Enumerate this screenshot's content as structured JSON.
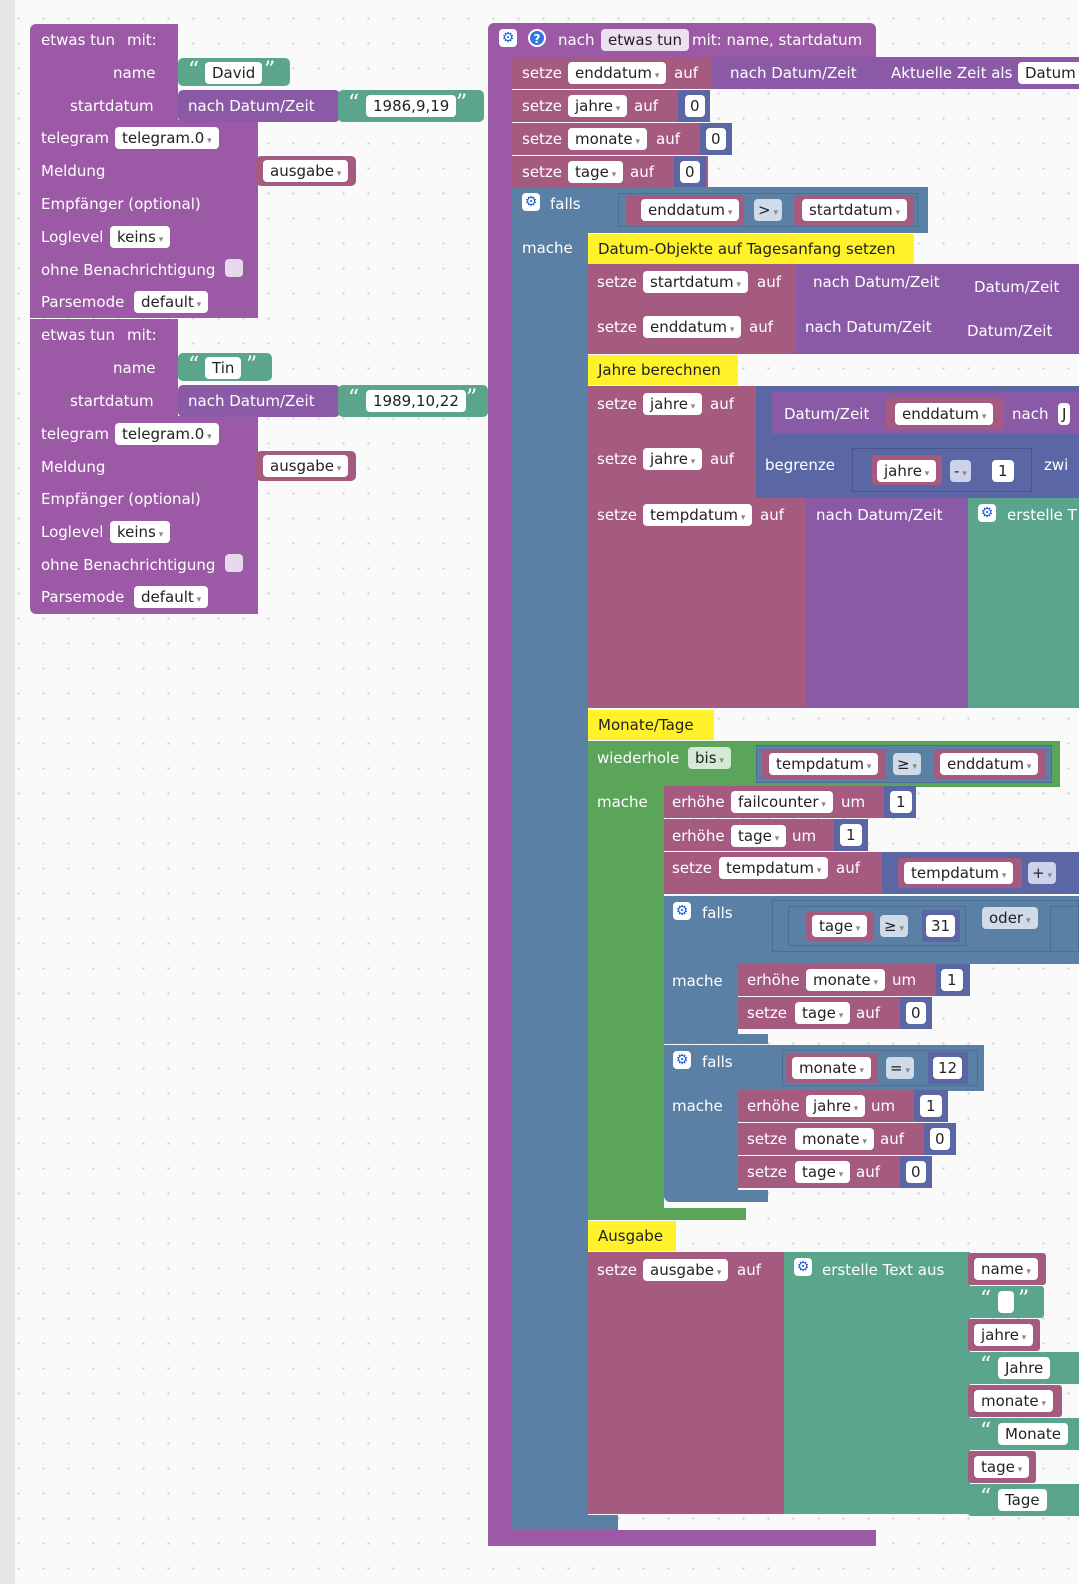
{
  "left_blocks": [
    {
      "header": "etwas tun",
      "mit": "mit:",
      "param1": "name",
      "param1_value": "David",
      "param2": "startdatum",
      "param2_conv": "nach Datum/Zeit",
      "param2_value": "1986,9,19",
      "telegram_label": "telegram",
      "telegram_instance": "telegram.0",
      "meldung_label": "Meldung",
      "meldung_var": "ausgabe",
      "empfaenger_label": "Empfänger (optional)",
      "loglevel_label": "Loglevel",
      "loglevel_value": "keins",
      "ohne_label": "ohne Benachrichtigung",
      "parsemode_label": "Parsemode",
      "parsemode_value": "default"
    },
    {
      "header": "etwas tun",
      "mit": "mit:",
      "param1": "name",
      "param1_value": "Tin",
      "param2": "startdatum",
      "param2_conv": "nach Datum/Zeit",
      "param2_value": "1989,10,22",
      "telegram_label": "telegram",
      "telegram_instance": "telegram.0",
      "meldung_label": "Meldung",
      "meldung_var": "ausgabe",
      "empfaenger_label": "Empfänger (optional)",
      "loglevel_label": "Loglevel",
      "loglevel_value": "keins",
      "ohne_label": "ohne Benachrichtigung",
      "parsemode_label": "Parsemode",
      "parsemode_value": "default"
    }
  ],
  "func": {
    "nach": "nach",
    "name": "etwas tun",
    "params": "mit: name, startdatum",
    "kw": {
      "setze": "setze",
      "auf": "auf",
      "falls": "falls",
      "mache": "mache",
      "erhoehe": "erhöhe",
      "um": "um",
      "nach_datum": "nach Datum/Zeit",
      "datum_zeit": "Datum/Zeit",
      "begrenze": "begrenze",
      "erstelle": "erstelle T",
      "erstelle_text": "erstelle Text aus",
      "wiederhole": "wiederhole",
      "bis": "bis",
      "oder": "oder",
      "aktuelle_zeit": "Aktuelle Zeit als",
      "datum_cut": "Datum",
      "nach_cut": "nach",
      "j_cut": "J",
      "zwi_cut": "zwi"
    },
    "vars": {
      "enddatum": "enddatum",
      "jahre": "jahre",
      "monate": "monate",
      "tage": "tage",
      "startdatum": "startdatum",
      "tempdatum": "tempdatum",
      "failcounter": "failcounter",
      "ausgabe": "ausgabe",
      "name": "name"
    },
    "nums": {
      "zero": "0",
      "one": "1",
      "n31": "31",
      "n12": "12"
    },
    "ops": {
      "gt": ">",
      "ge": "≥",
      "minus": "-",
      "plus": "+",
      "eq": "="
    },
    "comments": {
      "c1": "Datum-Objekte auf Tagesanfang setzen",
      "c2": "Jahre berechnen",
      "c3": "Monate/Tage",
      "c4": "Ausgabe"
    },
    "text_parts": {
      "jahre": "Jahre",
      "monate": "Monate",
      "tage": "Tage"
    }
  },
  "colors": {
    "procedure": "#9c59a6",
    "variables": "#a55b80",
    "logic": "#5b80a5",
    "loops": "#5ba55b",
    "text": "#5ba58c",
    "datetime": "#8a5aa6",
    "math": "#5b67a5",
    "comment": "#fff12a"
  }
}
